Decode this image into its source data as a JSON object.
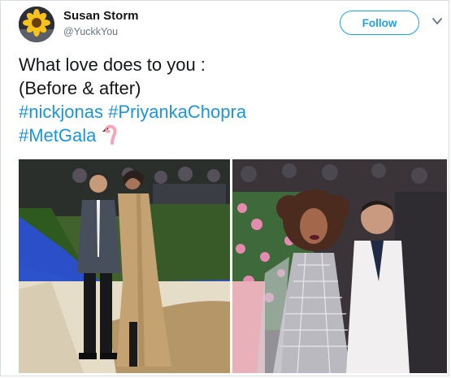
{
  "user": {
    "display_name": "Susan Storm",
    "handle": "@YuckkYou",
    "avatar_icon": "sunflower-avatar-icon"
  },
  "actions": {
    "follow_label": "Follow",
    "menu_icon": "chevron-down-icon"
  },
  "tweet": {
    "line1": "What love does to you :",
    "line2": "(Before & after)",
    "hashtag1": "#nickjonas",
    "hashtag2": "#PriyankaChopra",
    "hashtag3": "#MetGala",
    "emoji": "flamingo-emoji-icon"
  },
  "media": {
    "before_photo": "couple-met-gala-2017-photo",
    "after_photo": "couple-met-gala-2019-photo"
  },
  "colors": {
    "accent": "#1da1f2",
    "hashtag": "#1b95e0",
    "name": "#14171a",
    "muted": "#657786"
  }
}
